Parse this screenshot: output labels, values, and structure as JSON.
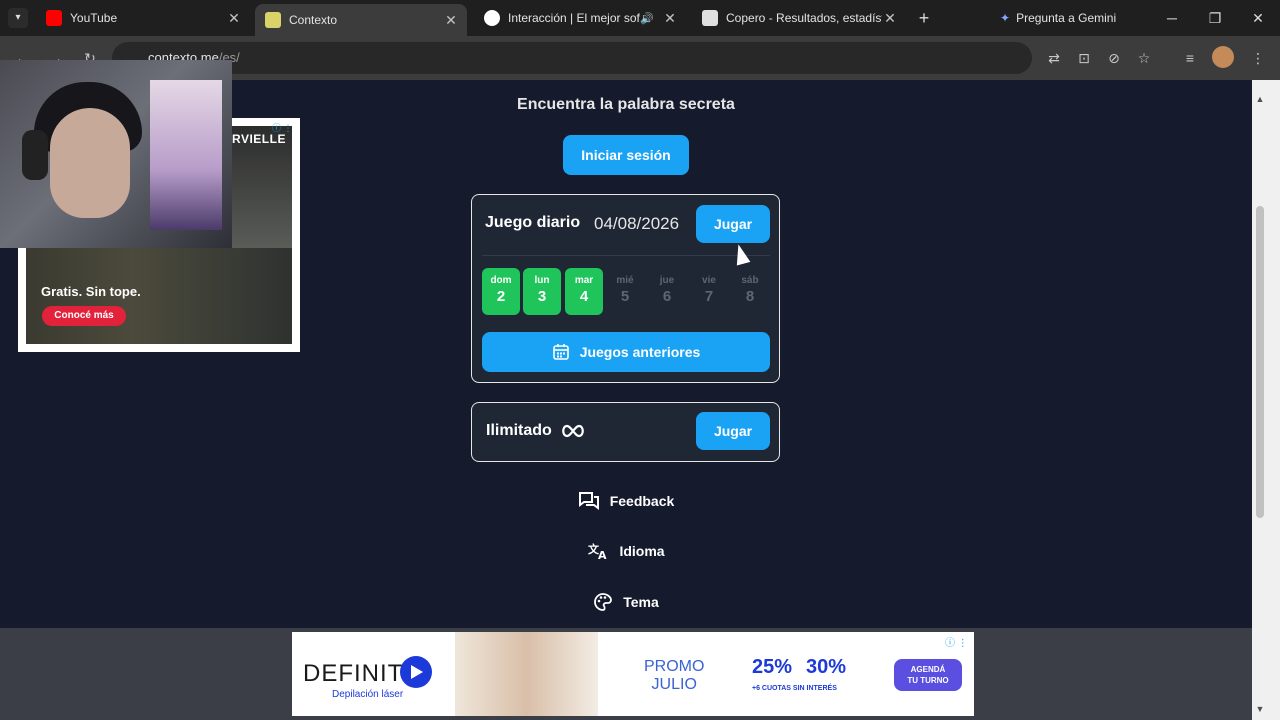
{
  "browser": {
    "tabs": [
      {
        "title": "YouTube",
        "favicon_color": "#ff0000"
      },
      {
        "title": "Contexto",
        "favicon_color": "#d9d36a"
      },
      {
        "title": "Interacción | El mejor softw",
        "favicon_color": "#ffffff"
      },
      {
        "title": "Copero - Resultados, estadístic",
        "favicon_color": "#e0e0e0"
      }
    ],
    "gemini_label": "Pregunta a Gemini",
    "url_host": "contexto.me",
    "url_path": "/es/"
  },
  "page": {
    "headline": "Encuentra la palabra secreta",
    "login_button": "Iniciar sesión",
    "daily": {
      "label": "Juego diario",
      "date": "04/08/2026",
      "play_button": "Jugar",
      "days": [
        {
          "name": "dom",
          "num": "2",
          "status": "done"
        },
        {
          "name": "lun",
          "num": "3",
          "status": "done"
        },
        {
          "name": "mar",
          "num": "4",
          "status": "done"
        },
        {
          "name": "mié",
          "num": "5",
          "status": "future"
        },
        {
          "name": "jue",
          "num": "6",
          "status": "future"
        },
        {
          "name": "vie",
          "num": "7",
          "status": "future"
        },
        {
          "name": "sáb",
          "num": "8",
          "status": "future"
        }
      ],
      "previous_button": "Juegos anteriores"
    },
    "unlimited": {
      "label": "Ilimitado",
      "play_button": "Jugar"
    },
    "links": {
      "feedback": "Feedback",
      "language": "Idioma",
      "theme": "Tema"
    }
  },
  "ads": {
    "left": {
      "brand": "RVIELLE",
      "text": "Gratis. Sin tope.",
      "cta": "Conocé más"
    },
    "bottom": {
      "brand": "DEFINIT",
      "sub": "Depilación láser",
      "promo_line1": "PROMO",
      "promo_line2": "JULIO",
      "deal1": "25%",
      "deal2": "30%",
      "cuotas": "+6 CUOTAS SIN INTERÉS",
      "cta_line1": "AGENDÁ",
      "cta_line2": "TU TURNO"
    }
  },
  "colors": {
    "accent": "#1aa3f5",
    "success": "#1fc55b",
    "background": "#151a2d"
  }
}
